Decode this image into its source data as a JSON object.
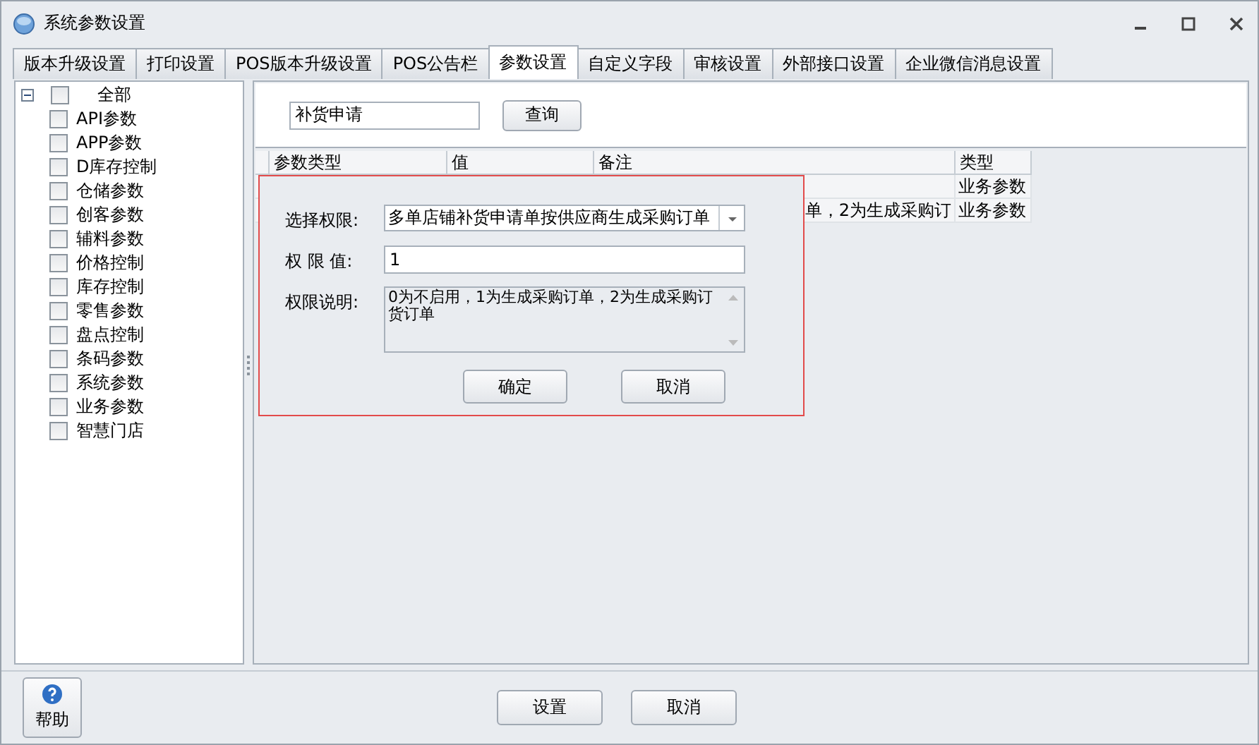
{
  "window": {
    "title": "系统参数设置"
  },
  "tabs": [
    {
      "label": "版本升级设置",
      "selected": false
    },
    {
      "label": "打印设置",
      "selected": false
    },
    {
      "label": "POS版本升级设置",
      "selected": false
    },
    {
      "label": "POS公告栏",
      "selected": false
    },
    {
      "label": "参数设置",
      "selected": true
    },
    {
      "label": "自定义字段",
      "selected": false
    },
    {
      "label": "审核设置",
      "selected": false
    },
    {
      "label": "外部接口设置",
      "selected": false
    },
    {
      "label": "企业微信消息设置",
      "selected": false
    }
  ],
  "tree": {
    "label": "全部",
    "checked": false,
    "expanded": true,
    "children": [
      {
        "label": "API参数",
        "checked": false
      },
      {
        "label": "APP参数",
        "checked": false
      },
      {
        "label": "D库存控制",
        "checked": false
      },
      {
        "label": "仓储参数",
        "checked": false
      },
      {
        "label": "创客参数",
        "checked": false
      },
      {
        "label": "辅料参数",
        "checked": false
      },
      {
        "label": "价格控制",
        "checked": false
      },
      {
        "label": "库存控制",
        "checked": false
      },
      {
        "label": "零售参数",
        "checked": false
      },
      {
        "label": "盘点控制",
        "checked": false
      },
      {
        "label": "条码参数",
        "checked": false
      },
      {
        "label": "系统参数",
        "checked": false
      },
      {
        "label": "业务参数",
        "checked": false
      },
      {
        "label": "智慧门店",
        "checked": false
      }
    ]
  },
  "search": {
    "value": "补货申请",
    "button": "查询"
  },
  "table": {
    "columns": [
      "参数类型",
      "值",
      "备注",
      "类型"
    ],
    "rows": [
      [
        "",
        "",
        "",
        "业务参数"
      ],
      [
        "",
        "",
        "单，2为生成采购订",
        "业务参数"
      ]
    ]
  },
  "dialog": {
    "fields": [
      {
        "kind": "select",
        "label": "选择权限:",
        "value": "多单店铺补货申请单按供应商生成采购订单"
      },
      {
        "kind": "input",
        "label": "权 限 值:",
        "value": "1"
      },
      {
        "kind": "textarea",
        "label": "权限说明:",
        "value": "0为不启用，1为生成采购订单，2为生成采购订货订单"
      }
    ],
    "buttons": [
      "确定",
      "取消"
    ]
  },
  "footer": {
    "help": "帮助",
    "buttons": [
      "设置",
      "取消"
    ]
  }
}
